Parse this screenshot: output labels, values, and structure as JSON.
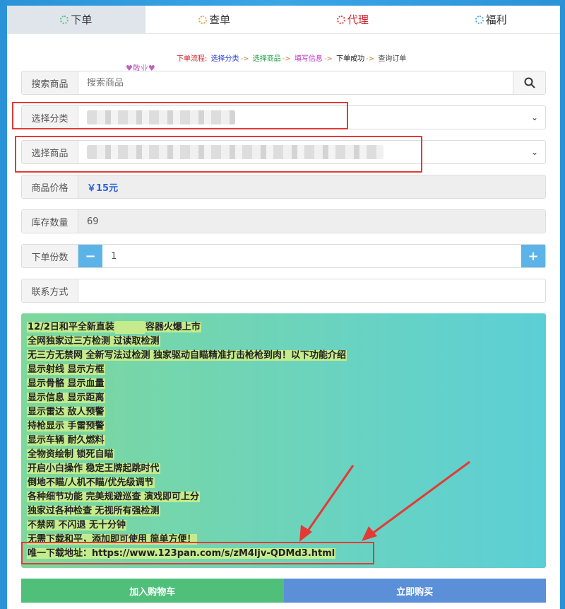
{
  "tabs": [
    {
      "label": "下单"
    },
    {
      "label": "查单"
    },
    {
      "label": "代理"
    },
    {
      "label": "福利"
    }
  ],
  "flow": {
    "prefix": "下单流程:",
    "step1": "选择分类",
    "step2": "选择商品",
    "step3": "填写信息",
    "step4": "下单成功",
    "step5": "查询订单",
    "sep": "->"
  },
  "decor_text": "♥敬业♥",
  "search": {
    "label": "搜索商品",
    "placeholder": "搜索商品"
  },
  "category": {
    "label": "选择分类"
  },
  "product": {
    "label": "选择商品"
  },
  "price": {
    "label": "商品价格",
    "value": "￥15元"
  },
  "stock": {
    "label": "库存数量",
    "value": "69"
  },
  "quantity": {
    "label": "下单份数",
    "value": "1",
    "minus": "−",
    "plus": "+"
  },
  "contact": {
    "label": "联系方式",
    "value": ""
  },
  "notice_lines": [
    "12/2日和平全新直装",
    "容器火爆上市",
    "全网独家过三方检测 过读取检测",
    "无三方无禁网 全新写法过检测 独家驱动自瞄精准打击枪枪到肉！以下功能介绍",
    "显示射线  显示方框",
    "显示骨骼  显示血量",
    "显示信息  显示距离",
    "显示雷达  敌人预警",
    "持枪显示  手雷预警",
    "显示车辆  耐久燃料",
    "全物资绘制  锁死自瞄",
    "开启小白操作 稳定王牌起跳时代",
    "倒地不瞄/人机不瞄/优先级调节",
    "各种细节功能 完美规避巡查 演戏即可上分",
    "独家过各种检查 无视所有强检测",
    "不禁网 不闪退 无十分钟",
    "无需下载和平，添加即可使用 简单方便！",
    "唯一下载地址：https://www.123pan.com/s/zM4ljv-QDMd3.html"
  ],
  "buttons": {
    "cart": "加入购物车",
    "buy": "立即购买"
  },
  "colors": {
    "price": "#2f62d8",
    "highlight_box": "#e53935",
    "cart": "#4fbf79",
    "buy": "#5b8fd8"
  }
}
